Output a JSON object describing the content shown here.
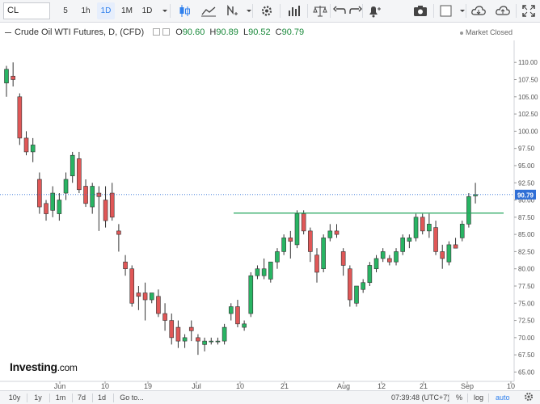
{
  "toolbar": {
    "symbol": "CL",
    "intervals": [
      "5",
      "1h",
      "1D",
      "1M",
      "1D"
    ],
    "active_interval": "1D",
    "icons": [
      "candles-icon",
      "area-chart-icon",
      "indicators-icon",
      "settings-icon",
      "bar-chart-icon",
      "scale-icon",
      "undo-icon",
      "redo-icon",
      "alert-icon",
      "camera-icon",
      "layout-icon",
      "cloud-load-icon",
      "cloud-save-icon",
      "fullscreen-icon"
    ]
  },
  "legend": {
    "title": "Crude Oil WTI Futures, D, (CFD)",
    "open_key": "O",
    "open": "90.60",
    "high_key": "H",
    "high": "90.89",
    "low_key": "L",
    "low": "90.52",
    "close_key": "C",
    "close": "90.79",
    "status": "Market Closed"
  },
  "price_tag": "90.79",
  "logo": {
    "name": "Investing",
    "suffix": ".com"
  },
  "bottom": {
    "ranges": [
      "10y",
      "1y",
      "1m",
      "7d",
      "1d"
    ],
    "goto": "Go to...",
    "clock": "07:39:48 (UTC+7)",
    "percent": "%",
    "log": "log",
    "auto": "auto"
  },
  "colors": {
    "up": "#28b463",
    "down": "#e05757",
    "hline": "#22a55b",
    "price_line": "#2f6fd6"
  },
  "chart_data": {
    "type": "candlestick",
    "title": "Crude Oil WTI Futures, D, (CFD)",
    "y_ticks": [
      "65.00",
      "67.50",
      "70.00",
      "72.50",
      "75.00",
      "77.50",
      "80.00",
      "82.50",
      "85.00",
      "87.50",
      "90.00",
      "92.50",
      "95.00",
      "97.50",
      "100.00",
      "102.50",
      "105.00",
      "107.50",
      "110.00"
    ],
    "ylim": [
      64.7,
      111.2
    ],
    "x_ticks": [
      "Jun",
      "10",
      "19",
      "Jul",
      "10",
      "21",
      "Aug",
      "12",
      "21",
      "Sep",
      "10"
    ],
    "last_price": 90.79,
    "horizontal_line": 88.1,
    "ohlc": [
      [
        107.0,
        109.5,
        105.0,
        109.0
      ],
      [
        108.0,
        110.0,
        106.5,
        107.5
      ],
      [
        105.0,
        105.5,
        98.0,
        99.0
      ],
      [
        99.0,
        100.0,
        96.5,
        97.0
      ],
      [
        97.0,
        99.0,
        95.5,
        98.0
      ],
      [
        93.0,
        94.0,
        88.0,
        89.0
      ],
      [
        89.5,
        90.0,
        87.0,
        88.0
      ],
      [
        88.5,
        92.0,
        87.5,
        91.0
      ],
      [
        88.0,
        91.0,
        87.0,
        90.0
      ],
      [
        91.0,
        94.0,
        90.0,
        93.0
      ],
      [
        93.5,
        97.0,
        92.5,
        96.5
      ],
      [
        96.0,
        97.0,
        91.0,
        91.5
      ],
      [
        92.0,
        93.0,
        89.0,
        89.5
      ],
      [
        89.0,
        92.5,
        88.0,
        92.0
      ],
      [
        91.0,
        92.0,
        85.5,
        90.5
      ],
      [
        90.0,
        92.0,
        86.0,
        87.0
      ],
      [
        91.0,
        92.5,
        87.0,
        87.5
      ],
      [
        85.5,
        86.5,
        82.5,
        85.0
      ],
      [
        81.0,
        82.0,
        79.0,
        80.0
      ],
      [
        80.0,
        80.5,
        74.5,
        75.0
      ],
      [
        76.5,
        77.5,
        74.0,
        76.0
      ],
      [
        76.5,
        78.0,
        72.5,
        75.5
      ],
      [
        75.5,
        76.5,
        75.0,
        76.5
      ],
      [
        76.0,
        77.0,
        73.0,
        73.5
      ],
      [
        73.5,
        75.0,
        71.0,
        72.5
      ],
      [
        72.5,
        73.5,
        69.0,
        70.0
      ],
      [
        71.5,
        72.5,
        68.5,
        69.5
      ],
      [
        69.5,
        70.5,
        68.5,
        70.0
      ],
      [
        71.5,
        72.5,
        69.5,
        71.0
      ],
      [
        70.0,
        70.5,
        67.5,
        69.5
      ],
      [
        69.0,
        70.0,
        68.0,
        69.5
      ],
      [
        69.5,
        70.0,
        69.0,
        69.5
      ],
      [
        69.5,
        70.0,
        69.0,
        69.5
      ],
      [
        69.5,
        72.0,
        69.0,
        71.5
      ],
      [
        73.5,
        75.0,
        72.5,
        74.5
      ],
      [
        74.5,
        75.5,
        71.5,
        72.0
      ],
      [
        71.5,
        72.5,
        71.0,
        72.0
      ],
      [
        73.5,
        79.5,
        73.0,
        79.0
      ],
      [
        79.0,
        80.5,
        78.5,
        80.0
      ],
      [
        79.0,
        81.5,
        78.5,
        80.0
      ],
      [
        78.5,
        81.0,
        78.0,
        81.0
      ],
      [
        81.0,
        83.0,
        80.0,
        82.5
      ],
      [
        82.5,
        85.0,
        82.0,
        84.5
      ],
      [
        84.5,
        85.5,
        81.5,
        84.0
      ],
      [
        83.5,
        88.5,
        83.0,
        88.0
      ],
      [
        88.0,
        88.5,
        85.0,
        85.5
      ],
      [
        85.5,
        86.0,
        81.0,
        82.5
      ],
      [
        82.0,
        83.0,
        78.0,
        79.5
      ],
      [
        80.0,
        85.0,
        79.5,
        84.5
      ],
      [
        84.5,
        86.5,
        84.0,
        85.5
      ],
      [
        85.5,
        86.5,
        84.5,
        85.0
      ],
      [
        82.5,
        83.0,
        79.0,
        80.5
      ],
      [
        80.0,
        80.5,
        74.5,
        75.5
      ],
      [
        75.0,
        77.0,
        74.5,
        77.5
      ],
      [
        77.0,
        78.5,
        76.5,
        78.0
      ],
      [
        78.0,
        81.0,
        77.5,
        80.5
      ],
      [
        80.0,
        82.0,
        79.5,
        81.5
      ],
      [
        81.5,
        83.0,
        81.0,
        82.5
      ],
      [
        81.5,
        82.0,
        80.5,
        81.0
      ],
      [
        81.0,
        83.0,
        80.5,
        82.5
      ],
      [
        82.5,
        85.0,
        82.0,
        84.5
      ],
      [
        84.0,
        85.0,
        83.0,
        84.5
      ],
      [
        84.5,
        88.0,
        84.0,
        87.5
      ],
      [
        87.5,
        88.0,
        85.0,
        85.5
      ],
      [
        85.5,
        88.0,
        84.5,
        86.5
      ],
      [
        86.0,
        87.0,
        82.0,
        82.5
      ],
      [
        82.5,
        83.5,
        80.0,
        81.5
      ],
      [
        81.0,
        84.0,
        80.5,
        83.5
      ],
      [
        83.5,
        84.5,
        83.0,
        83.0
      ],
      [
        84.5,
        87.0,
        84.0,
        86.5
      ],
      [
        86.5,
        91.0,
        86.0,
        90.5
      ],
      [
        90.6,
        92.5,
        89.5,
        90.79
      ]
    ]
  }
}
